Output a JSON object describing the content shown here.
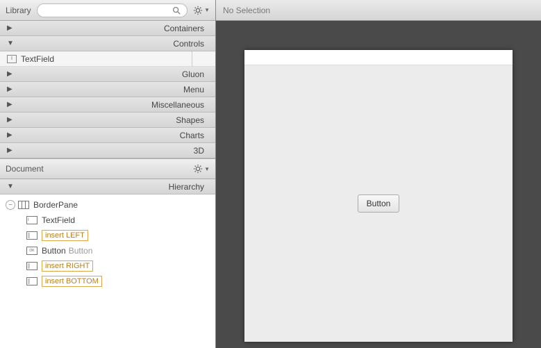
{
  "library": {
    "title": "Library",
    "search_placeholder": "",
    "sections": [
      {
        "label": "Containers",
        "expanded": false
      },
      {
        "label": "Controls",
        "expanded": true
      },
      {
        "label": "Gluon",
        "expanded": false
      },
      {
        "label": "Menu",
        "expanded": false
      },
      {
        "label": "Miscellaneous",
        "expanded": false
      },
      {
        "label": "Shapes",
        "expanded": false
      },
      {
        "label": "Charts",
        "expanded": false
      },
      {
        "label": "3D",
        "expanded": false
      }
    ],
    "controls_items": [
      {
        "label": "TextField"
      }
    ]
  },
  "document": {
    "title": "Document",
    "subsection": "Hierarchy",
    "tree": {
      "root": {
        "label": "BorderPane"
      },
      "children": [
        {
          "type": "node",
          "label": "TextField"
        },
        {
          "type": "placeholder",
          "label": "insert LEFT"
        },
        {
          "type": "node",
          "label": "Button",
          "sub": "Button"
        },
        {
          "type": "placeholder",
          "label": "insert RIGHT"
        },
        {
          "type": "placeholder",
          "label": "insert BOTTOM"
        }
      ]
    }
  },
  "inspector": {
    "status": "No Selection"
  },
  "preview": {
    "button_label": "Button"
  }
}
